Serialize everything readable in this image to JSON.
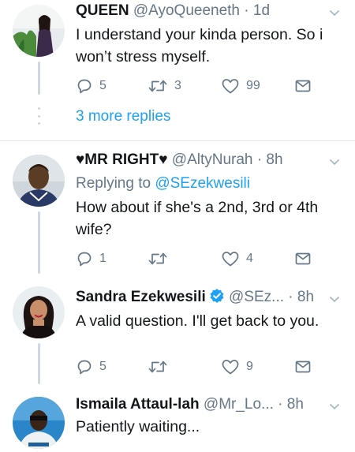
{
  "tweets": [
    {
      "name": "QUEEN",
      "handle": "@AyoQueeneth",
      "time": "1d",
      "text": "I understand your kinda person. So i won’t stress myself.",
      "replies": "5",
      "retweets": "3",
      "likes": "99",
      "more_replies": "3 more replies"
    },
    {
      "name": "♥MR RIGHT♥",
      "handle": "@AltyNurah",
      "time": "8h",
      "replying_label": "Replying to",
      "replying_to": "@SEzekwesili",
      "text": "How about if she's a 2nd, 3rd or 4th wife?",
      "replies": "1",
      "retweets": "",
      "likes": "4"
    },
    {
      "name": "Sandra Ezekwesili",
      "handle": "@SEz...",
      "time": "8h",
      "text": "A valid question. I'll get back to you.",
      "replies": "5",
      "retweets": "",
      "likes": "9"
    },
    {
      "name": "Ismaila Attaul-lah",
      "handle": "@Mr_Lo...",
      "time": "8h",
      "text": "Patiently waiting..."
    }
  ],
  "separator": "·",
  "colors": {
    "link": "#1da1f2",
    "muted": "#657786",
    "text": "#14171a",
    "verified": "#1da1f2",
    "divider": "#e1e8ed"
  },
  "icons": {
    "reply": "reply-icon",
    "retweet": "retweet-icon",
    "like": "heart-icon",
    "dm": "envelope-icon",
    "menu": "chevron-down-icon",
    "verified": "verified-badge-icon"
  }
}
